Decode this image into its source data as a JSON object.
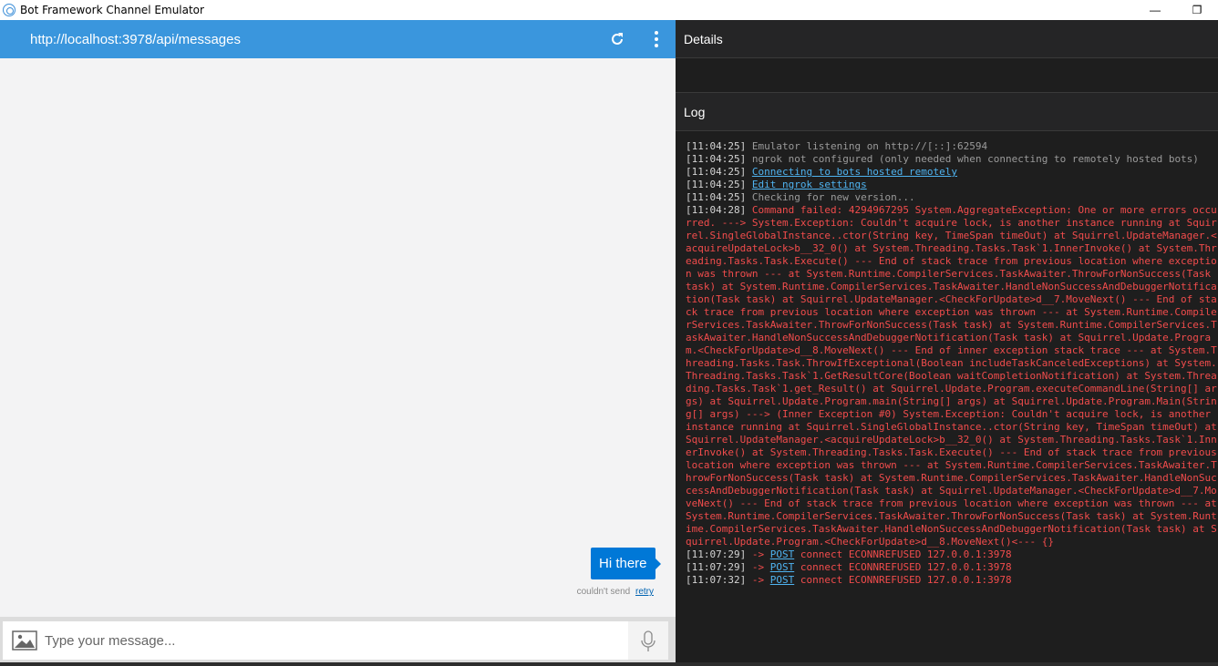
{
  "window": {
    "title": "Bot Framework Channel Emulator",
    "controls": {
      "minimize": "—",
      "restore": "❐"
    }
  },
  "chat": {
    "endpoint_url": "http://localhost:3978/api/messages",
    "messages": [
      {
        "text": "Hi there",
        "status": "couldn't send",
        "retry_label": "retry"
      }
    ],
    "input_placeholder": "Type your message..."
  },
  "details": {
    "title": "Details"
  },
  "log": {
    "title": "Log",
    "entries": [
      {
        "time": "[11:04:25]",
        "type": "info",
        "text": "Emulator listening on http://[::]:62594"
      },
      {
        "time": "[11:04:25]",
        "type": "info",
        "text": "ngrok not configured (only needed when connecting to remotely hosted bots)"
      },
      {
        "time": "[11:04:25]",
        "type": "link",
        "text": "Connecting to bots hosted remotely"
      },
      {
        "time": "[11:04:25]",
        "type": "link",
        "text": "Edit ngrok settings"
      },
      {
        "time": "[11:04:25]",
        "type": "info",
        "text": "Checking for new version..."
      },
      {
        "time": "[11:04:28]",
        "type": "error",
        "text": "Command failed: 4294967295 System.AggregateException: One or more errors occurred. ---> System.Exception: Couldn't acquire lock, is another instance running at Squirrel.SingleGlobalInstance..ctor(String key, TimeSpan timeOut) at Squirrel.UpdateManager.<acquireUpdateLock>b__32_0() at System.Threading.Tasks.Task`1.InnerInvoke() at System.Threading.Tasks.Task.Execute() --- End of stack trace from previous location where exception was thrown --- at System.Runtime.CompilerServices.TaskAwaiter.ThrowForNonSuccess(Task task) at System.Runtime.CompilerServices.TaskAwaiter.HandleNonSuccessAndDebuggerNotification(Task task) at Squirrel.UpdateManager.<CheckForUpdate>d__7.MoveNext() --- End of stack trace from previous location where exception was thrown --- at System.Runtime.CompilerServices.TaskAwaiter.ThrowForNonSuccess(Task task) at System.Runtime.CompilerServices.TaskAwaiter.HandleNonSuccessAndDebuggerNotification(Task task) at Squirrel.Update.Program.<CheckForUpdate>d__8.MoveNext() --- End of inner exception stack trace --- at System.Threading.Tasks.Task.ThrowIfExceptional(Boolean includeTaskCanceledExceptions) at System.Threading.Tasks.Task`1.GetResultCore(Boolean waitCompletionNotification) at System.Threading.Tasks.Task`1.get_Result() at Squirrel.Update.Program.executeCommandLine(String[] args) at Squirrel.Update.Program.main(String[] args) at Squirrel.Update.Program.Main(String[] args) ---> (Inner Exception #0) System.Exception: Couldn't acquire lock, is another instance running at Squirrel.SingleGlobalInstance..ctor(String key, TimeSpan timeOut) at Squirrel.UpdateManager.<acquireUpdateLock>b__32_0() at System.Threading.Tasks.Task`1.InnerInvoke() at System.Threading.Tasks.Task.Execute() --- End of stack trace from previous location where exception was thrown --- at System.Runtime.CompilerServices.TaskAwaiter.ThrowForNonSuccess(Task task) at System.Runtime.CompilerServices.TaskAwaiter.HandleNonSuccessAndDebuggerNotification(Task task) at Squirrel.UpdateManager.<CheckForUpdate>d__7.MoveNext() --- End of stack trace from previous location where exception was thrown --- at System.Runtime.CompilerServices.TaskAwaiter.ThrowForNonSuccess(Task task) at System.Runtime.CompilerServices.TaskAwaiter.HandleNonSuccessAndDebuggerNotification(Task task) at Squirrel.Update.Program.<CheckForUpdate>d__8.MoveNext()<--- {}"
      },
      {
        "time": "[11:07:29]",
        "type": "post",
        "arrow": "->",
        "method": "POST",
        "text": "connect ECONNREFUSED 127.0.0.1:3978"
      },
      {
        "time": "[11:07:29]",
        "type": "post",
        "arrow": "->",
        "method": "POST",
        "text": "connect ECONNREFUSED 127.0.0.1:3978"
      },
      {
        "time": "[11:07:32]",
        "type": "post",
        "arrow": "->",
        "method": "POST",
        "text": "connect ECONNREFUSED 127.0.0.1:3978"
      }
    ]
  },
  "colors": {
    "header_blue": "#3a96dd",
    "bubble_blue": "#0078d7",
    "log_error": "#f14c4c",
    "log_link": "#4fb3f0",
    "panel_bg": "#1e1e1e"
  }
}
